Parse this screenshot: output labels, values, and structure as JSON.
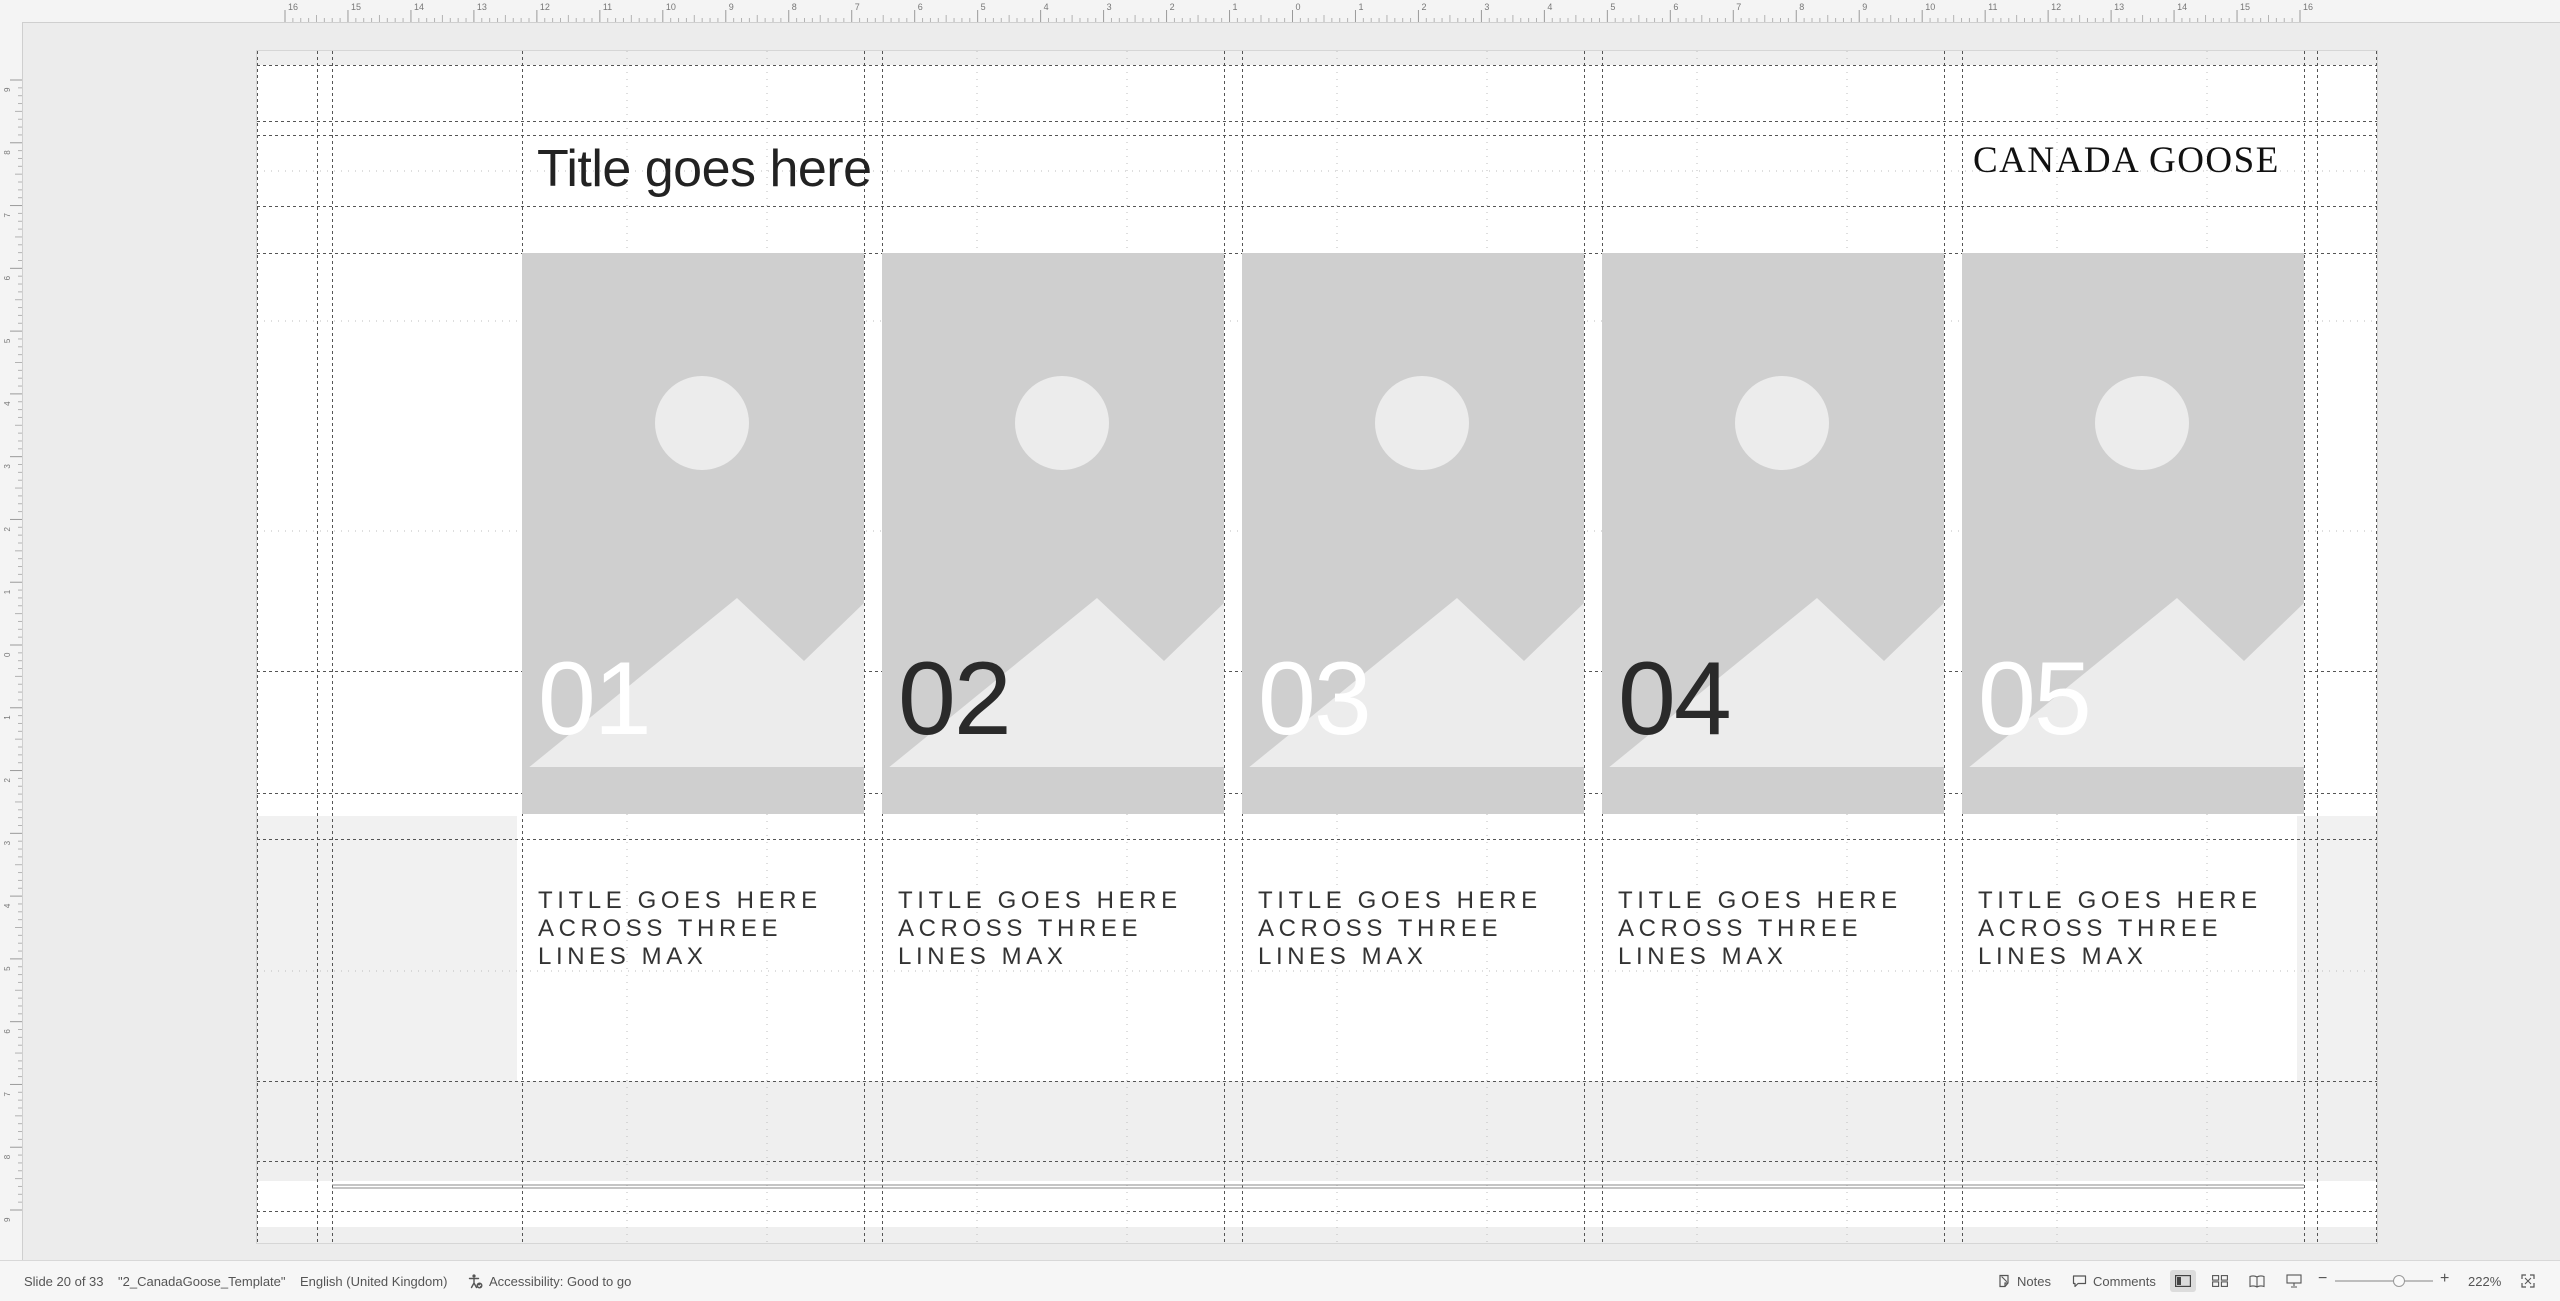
{
  "ruler": {
    "h_labels": [
      "16",
      "15",
      "14",
      "13",
      "12",
      "11",
      "10",
      "9",
      "8",
      "7",
      "6",
      "5",
      "4",
      "3",
      "2",
      "1",
      "0",
      "1",
      "2",
      "3",
      "4",
      "5",
      "6",
      "7",
      "8",
      "9",
      "10",
      "11",
      "12",
      "13",
      "14",
      "15",
      "16"
    ],
    "v_labels": [
      "9",
      "8",
      "7",
      "6",
      "5",
      "4",
      "3",
      "2",
      "1",
      "0",
      "1",
      "2",
      "3",
      "4",
      "5",
      "6",
      "7",
      "8",
      "9"
    ]
  },
  "slide": {
    "title": "Title goes here",
    "brand": "CANADA GOOSE",
    "cards": [
      {
        "number": "01",
        "number_color": "#ffffff",
        "caption": [
          "TITLE GOES HERE",
          "ACROSS THREE",
          "LINES MAX"
        ]
      },
      {
        "number": "02",
        "number_color": "#2a2a2a",
        "caption": [
          "TITLE GOES HERE",
          "ACROSS THREE",
          "LINES MAX"
        ]
      },
      {
        "number": "03",
        "number_color": "#ffffff",
        "caption": [
          "TITLE GOES HERE",
          "ACROSS THREE",
          "LINES MAX"
        ]
      },
      {
        "number": "04",
        "number_color": "#2a2a2a",
        "caption": [
          "TITLE GOES HERE",
          "ACROSS THREE",
          "LINES MAX"
        ]
      },
      {
        "number": "05",
        "number_color": "#ffffff",
        "caption": [
          "TITLE GOES HERE",
          "ACROSS THREE",
          "LINES MAX"
        ]
      }
    ],
    "placeholder_icon": "image-placeholder-icon"
  },
  "statusbar": {
    "slide_position": "Slide 20 of 33",
    "file_name": "\"2_CanadaGoose_Template\"",
    "language": "English (United Kingdom)",
    "accessibility": "Accessibility: Good to go",
    "notes_label": "Notes",
    "comments_label": "Comments",
    "zoom_level": "222%",
    "zoom_minus": "−",
    "zoom_plus": "+"
  },
  "colors": {
    "placeholder_bg": "#cfcfcf",
    "placeholder_shape": "#ececec",
    "slide_bg": "#ffffff",
    "canvas_bg": "#ececec"
  }
}
